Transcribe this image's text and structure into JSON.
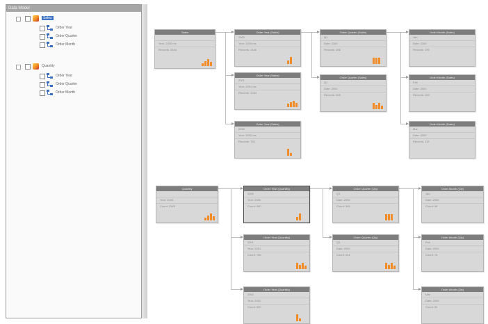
{
  "tree": {
    "title": "Data Model",
    "items": [
      {
        "label": "Sales",
        "kind": "cube",
        "selected": true,
        "expanded": true
      },
      {
        "label": "Order Year",
        "kind": "hierarchy"
      },
      {
        "label": "Order Quarter",
        "kind": "hierarchy"
      },
      {
        "label": "Order Month",
        "kind": "hierarchy"
      },
      {
        "label": "Quantity",
        "kind": "cube",
        "selected": false,
        "expanded": true
      },
      {
        "label": "Order Year",
        "kind": "hierarchy"
      },
      {
        "label": "Order Quarter",
        "kind": "hierarchy"
      },
      {
        "label": "Order Month",
        "kind": "hierarchy"
      }
    ]
  },
  "canvas": {
    "nodes": [
      {
        "title": "Sales",
        "lines": [
          "",
          "Year: 2000 ms",
          "Records: 3454"
        ],
        "bars": [
          4,
          7,
          10,
          6
        ]
      },
      {
        "title": "Order Year (Sales)",
        "lines": [
          "2000",
          "Year: 2000 ms",
          "Records: 1456"
        ],
        "bars": [
          5,
          10
        ]
      },
      {
        "title": "Order Year (Sales)",
        "lines": [
          "2001",
          "Year: 2001 ms",
          "Records: 1234"
        ],
        "bars": [
          5,
          7,
          9,
          6
        ]
      },
      {
        "title": "Order Year (Sales)",
        "lines": [
          "2002",
          "Year: 2002 ms",
          "Records: 764"
        ],
        "bars": [
          10,
          4
        ]
      },
      {
        "title": "Order Quarter (Sales)",
        "lines": [
          "Q1",
          "Date: 2000",
          "Records: 456"
        ],
        "bars": [
          9,
          9,
          9
        ]
      },
      {
        "title": "Order Quarter (Sales)",
        "lines": [
          "Q2",
          "Date: 2000",
          "Records: 345"
        ],
        "bars": [
          9,
          6,
          9,
          5
        ]
      },
      {
        "title": "Order Month (Sales)",
        "lines": [
          "Jan",
          "Date: 2000",
          "Records: 190"
        ],
        "bars": []
      },
      {
        "title": "Order Month (Sales)",
        "lines": [
          "Feb",
          "Date: 2000",
          "Records: 154"
        ],
        "bars": []
      },
      {
        "title": "Order Month (Sales)",
        "lines": [
          "Mar",
          "Date: 2000",
          "Records: 112"
        ],
        "bars": []
      },
      {
        "title": "Quantity",
        "lines": [
          "",
          "Year: 2000",
          "Count: 2345"
        ],
        "bars": [
          4,
          7,
          10,
          6
        ]
      },
      {
        "title": "Order Year (Quantity)",
        "lines": [
          "2000",
          "Year: 2000",
          "Count: 980"
        ],
        "bars": [
          5,
          10
        ]
      },
      {
        "title": "Order Year (Quantity)",
        "lines": [
          "2001",
          "Year: 2001",
          "Count: 765"
        ],
        "bars": [
          9,
          6,
          9,
          5
        ]
      },
      {
        "title": "Order Year (Quantity)",
        "lines": [
          "2002",
          "Year: 2002",
          "Count: 600"
        ],
        "bars": [
          10,
          4
        ]
      },
      {
        "title": "Order Quarter (Qty)",
        "lines": [
          "Q1",
          "Date: 2000",
          "Count: 345"
        ],
        "bars": [
          9,
          9,
          9
        ]
      },
      {
        "title": "Order Quarter (Qty)",
        "lines": [
          "Q2",
          "Date: 2000",
          "Count: 234"
        ],
        "bars": [
          9,
          6,
          9,
          5
        ]
      },
      {
        "title": "Order Month (Qty)",
        "lines": [
          "Jan",
          "Date: 2000",
          "Count: 98"
        ],
        "bars": []
      },
      {
        "title": "Order Month (Qty)",
        "lines": [
          "Feb",
          "Date: 2000",
          "Count: 76"
        ],
        "bars": []
      },
      {
        "title": "Order Month (Qty)",
        "lines": [
          "Mar",
          "Date: 2000",
          "Count: 54"
        ],
        "bars": []
      }
    ]
  },
  "colors": {
    "accent": "#f28c28",
    "node_title": "#7d7d7d",
    "selected": "#3d74c7"
  }
}
